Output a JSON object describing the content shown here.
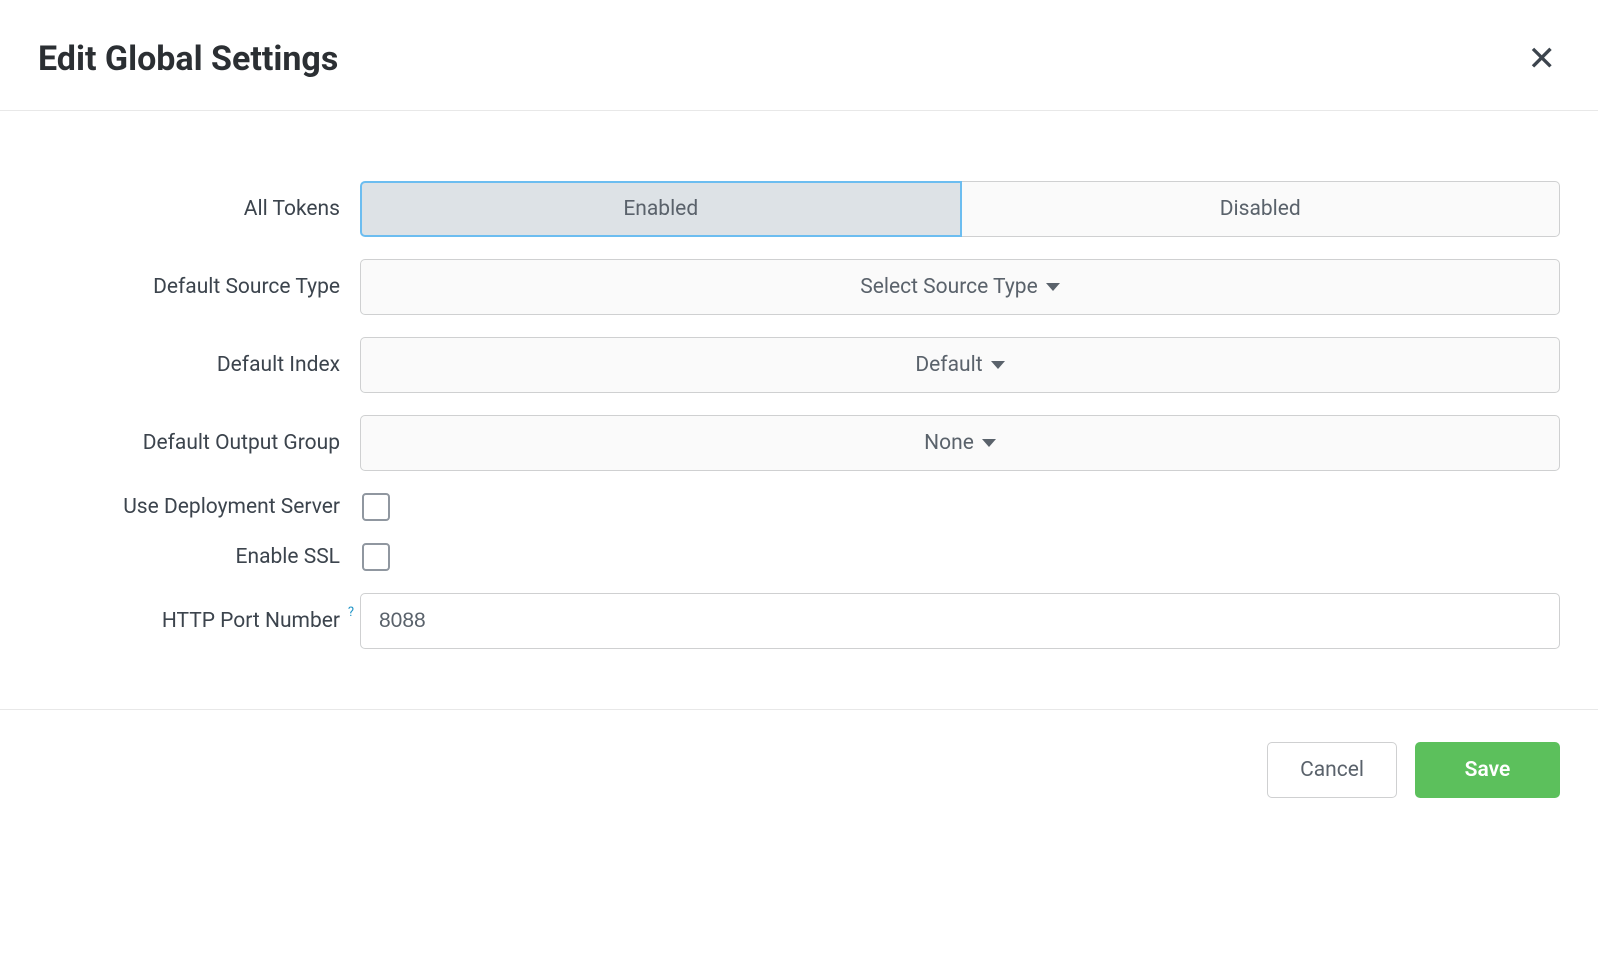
{
  "header": {
    "title": "Edit Global Settings"
  },
  "form": {
    "all_tokens": {
      "label": "All Tokens",
      "enabled_label": "Enabled",
      "disabled_label": "Disabled"
    },
    "default_source_type": {
      "label": "Default Source Type",
      "value": "Select Source Type"
    },
    "default_index": {
      "label": "Default Index",
      "value": "Default"
    },
    "default_output_group": {
      "label": "Default Output Group",
      "value": "None"
    },
    "use_deployment_server": {
      "label": "Use Deployment Server"
    },
    "enable_ssl": {
      "label": "Enable SSL"
    },
    "http_port": {
      "label": "HTTP Port Number",
      "value": "8088"
    }
  },
  "footer": {
    "cancel": "Cancel",
    "save": "Save"
  }
}
